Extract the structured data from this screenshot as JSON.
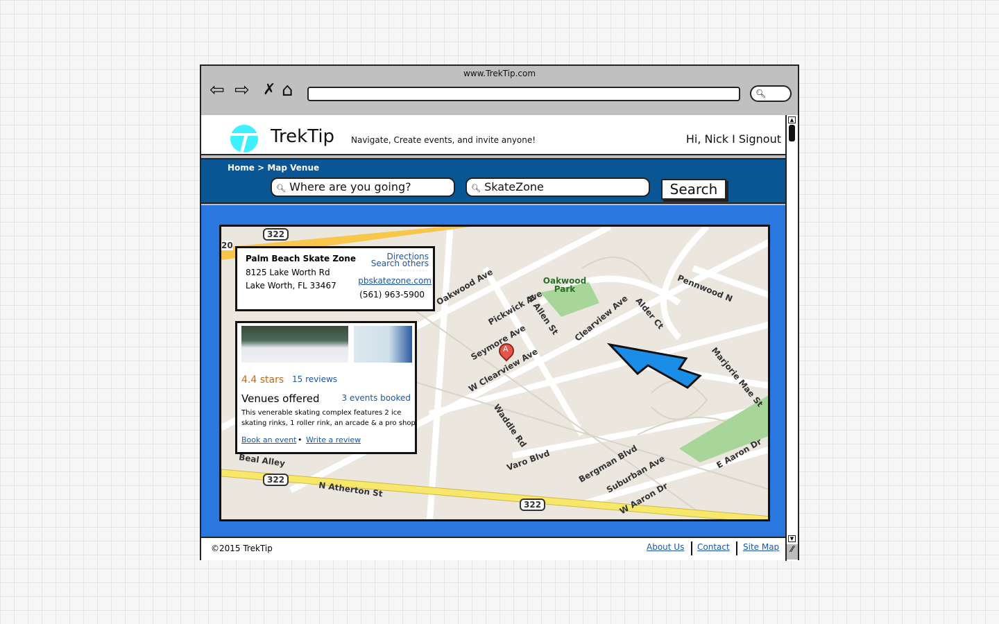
{
  "browser": {
    "url_title": "www.TrekTip.com"
  },
  "header": {
    "brand": "TrekTip",
    "tagline": "Navigate, Create events, and invite anyone!",
    "user": "Hi, Nick I Signout"
  },
  "nav": {
    "breadcrumb": "Home > Map Venue",
    "destination_placeholder": "Where are you going?",
    "venue_value": "SkateZone",
    "search_label": "Search"
  },
  "venue": {
    "name": "Palm Beach Skate Zone",
    "address1": "8125 Lake Worth Rd",
    "address2": "Lake Worth, FL 33467",
    "directions": "Directions",
    "search_others": "Search others",
    "website": "pbskatezone.com",
    "phone": "(561) 963-5900",
    "rating": "4.4 stars",
    "reviews": "15 reviews",
    "venues_offered": "Venues offered",
    "events_booked": "3 events booked",
    "description1": "This venerable skating complex features 2 ice",
    "description2": "skating rinks, 1 roller rink, an arcade & a pro shop.",
    "book": "Book an event",
    "write_review": "Write a review",
    "marker": "A"
  },
  "map": {
    "labels": [
      "322",
      "322",
      "322",
      "Oakwood Ave",
      "Oakwood Park",
      "Pennwood N",
      "Pickwick Ave",
      "N Allen St",
      "Clearview Ave",
      "Alder Ct",
      "Seymore Ave",
      "W Clearview Ave",
      "Waddle Rd",
      "Marjorie Mae St",
      "Varo Blvd",
      "Bergman Blvd",
      "Suburban Ave",
      "E Aaron Dr",
      "W Aaron Dr",
      "N Atherton St",
      "Beal Alley",
      "20"
    ]
  },
  "footer": {
    "copyright": "©2015 TrekTip",
    "links": [
      "About Us",
      "Contact",
      "Site Map"
    ]
  }
}
